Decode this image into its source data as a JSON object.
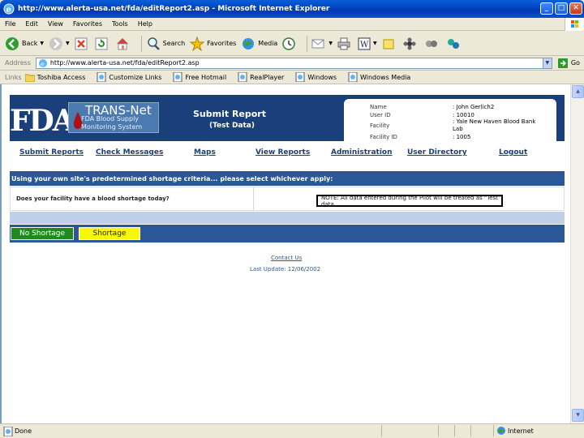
{
  "window": {
    "title": "http://www.alerta-usa.net/fda/editReport2.asp - Microsoft Internet Explorer"
  },
  "menu": [
    "File",
    "Edit",
    "View",
    "Favorites",
    "Tools",
    "Help"
  ],
  "toolbar": {
    "back": "Back",
    "search": "Search",
    "favorites": "Favorites",
    "media": "Media"
  },
  "address": {
    "label": "Address",
    "url": "http://www.alerta-usa.net/fda/editReport2.asp",
    "go": "Go"
  },
  "links": {
    "label": "Links",
    "items": [
      "Toshiba Access",
      "Customize Links",
      "Free Hotmail",
      "RealPlayer",
      "Windows",
      "Windows Media"
    ]
  },
  "header": {
    "logo": "FDA",
    "brand_title": "TRANS-Net",
    "brand_line1": "FDA Blood Supply",
    "brand_line2": "Monitoring System",
    "page_title": "Submit Report",
    "page_subtitle": "(Test Data)"
  },
  "user_info": {
    "name_label": "Name",
    "name_value": ": John Gerlich2",
    "userid_label": "User ID",
    "userid_value": ": 10010",
    "facility_label": "Facility",
    "facility_value_line1": ": Yale New Haven Blood Bank",
    "facility_value_line2": "Lab",
    "facilityid_label": "Facility ID",
    "facilityid_value": ": 1005"
  },
  "nav": [
    "Submit Reports",
    "Check Messages",
    "Maps",
    "View Reports",
    "Administration",
    "User Directory",
    "Logout"
  ],
  "content": {
    "criteria_text": "Using your own site's predetermined shortage criteria... please select whichever apply:",
    "question": "Does your facility have a blood shortage today?",
    "note": "NOTE: All data entered during the Pilot will be treated as \"Test\" data.",
    "no_shortage_label": "No Shortage",
    "shortage_label": "Shortage",
    "contact_label": "Contact Us",
    "last_update": "Last Update: 12/06/2002"
  },
  "status": {
    "left": "Done",
    "zone": "Internet"
  },
  "colors": {
    "header_blue": "#1b3f7a",
    "bar_blue": "#2b5797",
    "no_shortage_green": "#208a20",
    "shortage_yellow": "#f8f800"
  }
}
